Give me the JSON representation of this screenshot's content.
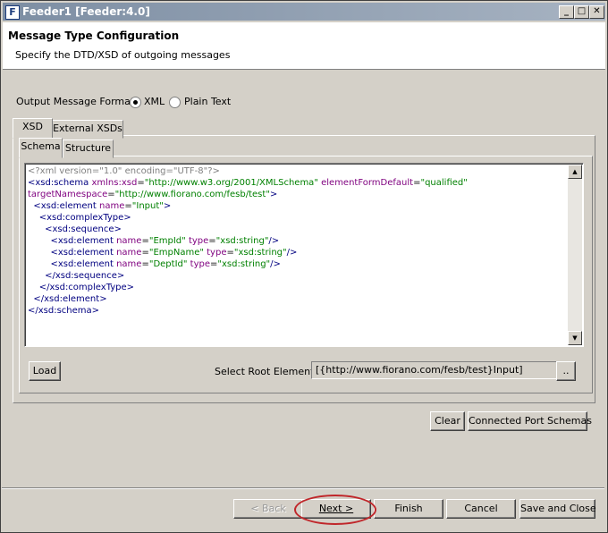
{
  "window": {
    "title": "Feeder1 [Feeder:4.0]",
    "icon": "app-icon",
    "controls": {
      "minimize": "_",
      "maximize": "□",
      "close": "✕"
    }
  },
  "header": {
    "title": "Message Type Configuration",
    "subtitle": "Specify the DTD/XSD of outgoing messages"
  },
  "format": {
    "label": "Output Message Format:",
    "options": [
      "XML",
      "Plain Text"
    ],
    "selected": "XML"
  },
  "tabs": {
    "outer": [
      "XSD",
      "External XSDs"
    ],
    "outer_selected": "XSD",
    "inner": [
      "Schema",
      "Structure"
    ],
    "inner_selected": "Schema"
  },
  "editor": {
    "lines": [
      "<?xml version=\"1.0\" encoding=\"UTF-8\"?>",
      "<xsd:schema xmlns:xsd=\"http://www.w3.org/2001/XMLSchema\" elementFormDefault=\"qualified\"",
      "targetNamespace=\"http://www.fiorano.com/fesb/test\">",
      "  <xsd:element name=\"Input\">",
      "    <xsd:complexType>",
      "      <xsd:sequence>",
      "        <xsd:element name=\"EmpId\" type=\"xsd:string\"/>",
      "        <xsd:element name=\"EmpName\" type=\"xsd:string\"/>",
      "        <xsd:element name=\"DeptId\" type=\"xsd:string\"/>",
      "      </xsd:sequence>",
      "    </xsd:complexType>",
      "  </xsd:element>",
      "</xsd:schema>"
    ]
  },
  "schema_controls": {
    "load_label": "Load",
    "root_label": "Select Root Element",
    "root_value": "[{http://www.fiorano.com/fesb/test}Input]",
    "browse_label": ".."
  },
  "actions": {
    "clear_label": "Clear",
    "ports_label": "Connected Port Schemas"
  },
  "footer": {
    "back_label": "< Back",
    "next_label": "Next >",
    "finish_label": "Finish",
    "cancel_label": "Cancel",
    "save_close_label": "Save and Close"
  },
  "colors": {
    "highlight": "#c0262a",
    "xml_tag": "#000080",
    "xml_attr": "#7f007f",
    "xml_value": "#008000",
    "xml_decl": "#808080"
  }
}
